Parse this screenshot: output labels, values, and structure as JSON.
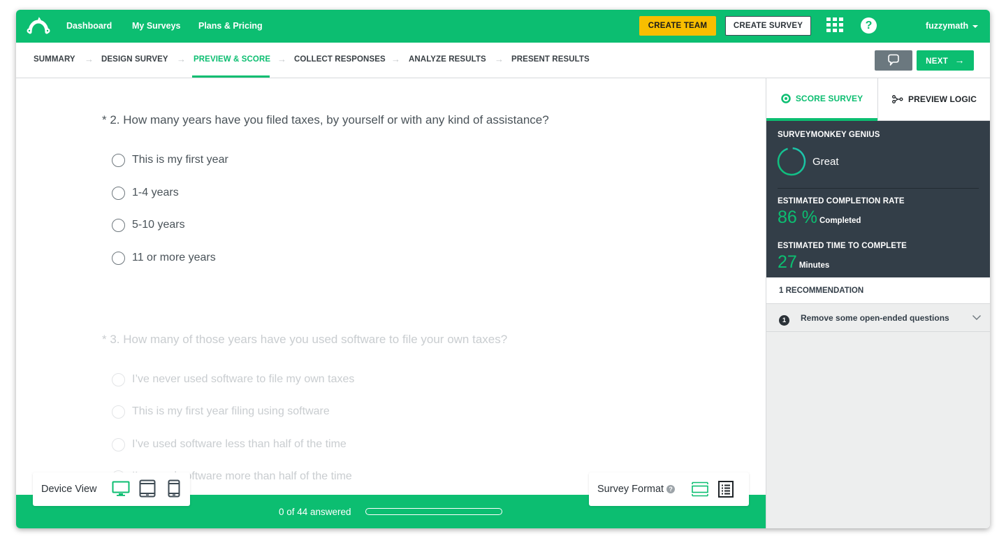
{
  "colors": {
    "brand_green": "#0cbe71",
    "create_team_yellow": "#f8be00",
    "genius_bg": "#333e48",
    "feedback_gray": "#6b787f"
  },
  "topnav": {
    "logo": "surveymonkey-logo-icon",
    "links": [
      "Dashboard",
      "My Surveys",
      "Plans & Pricing"
    ],
    "create_team": "CREATE TEAM",
    "create_survey": "CREATE SURVEY",
    "apps_icon": "apps-grid-icon",
    "help_icon_glyph": "?",
    "username": "fuzzymath"
  },
  "steps": {
    "items": [
      {
        "label": "SUMMARY",
        "active": false
      },
      {
        "label": "DESIGN SURVEY",
        "active": false
      },
      {
        "label": "PREVIEW & SCORE",
        "active": true
      },
      {
        "label": "COLLECT RESPONSES",
        "active": false
      },
      {
        "label": "ANALYZE RESULTS",
        "active": false
      },
      {
        "label": "PRESENT RESULTS",
        "active": false
      }
    ],
    "arrow_glyph": "→",
    "feedback_icon": "speech-bubble-icon",
    "next_label": "NEXT",
    "next_arrow": "→"
  },
  "survey": {
    "questions": [
      {
        "text": "* 2. How many years have you filed taxes, by yourself or with any kind of assistance?",
        "faded": false,
        "options": [
          "This is my first year",
          "1-4 years",
          "5-10 years",
          "11 or more years"
        ]
      },
      {
        "text": "* 3. How many of those years have you used software to file your own taxes?",
        "faded": true,
        "options": [
          "I’ve never used software to file my own taxes",
          "This is my first year filing using software",
          "I’ve used software less than half of the time",
          "I’ve used software more than half of the time"
        ]
      }
    ]
  },
  "bottombar": {
    "progress_text": "0 of 44 answered",
    "answered": 0,
    "total": 44,
    "progress_fraction": 0
  },
  "device_view": {
    "label": "Device View",
    "options": [
      {
        "name": "desktop",
        "selected": true
      },
      {
        "name": "tablet",
        "selected": false
      },
      {
        "name": "phone",
        "selected": false
      }
    ]
  },
  "survey_format": {
    "label": "Survey Format",
    "info_glyph": "?",
    "options": [
      {
        "name": "one-question-at-a-time",
        "selected": true
      },
      {
        "name": "classic",
        "selected": false
      }
    ]
  },
  "side_panel": {
    "tabs": [
      {
        "label": "SCORE SURVEY",
        "active": true
      },
      {
        "label": "PREVIEW LOGIC",
        "active": false
      }
    ],
    "genius": {
      "title": "SURVEYMONKEY GENIUS",
      "rating": "Great",
      "completion_title": "ESTIMATED COMPLETION RATE",
      "completion_value": "86 %",
      "completion_unit": "Completed",
      "time_title": "ESTIMATED TIME TO COMPLETE",
      "time_value": "27",
      "time_unit": "Minutes"
    },
    "recommendations_header": "1 RECOMMENDATION",
    "recommendations": [
      {
        "number": "1",
        "text": "Remove some open-ended questions"
      }
    ]
  }
}
